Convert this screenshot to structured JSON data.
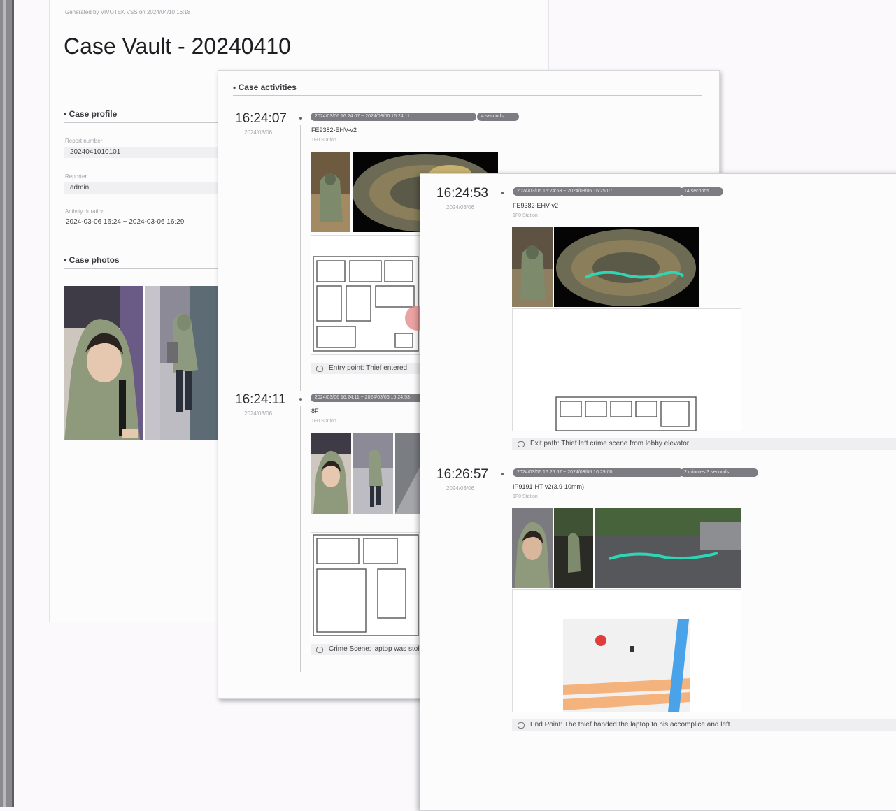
{
  "report": {
    "generated_line": "Generated by VIVOTEK VSS on 2024/04/10 16:18",
    "title": "Case Vault - 20240410",
    "profile": {
      "section_title": "Case profile",
      "report_number_label": "Report number",
      "report_number": "2024041010101",
      "reporter_label": "Reporter",
      "reporter": "admin",
      "duration_label": "Activity duration",
      "duration": "2024-03-06 16:24 ~ 2024-03-06 16:29"
    },
    "photos": {
      "section_title": "Case photos"
    }
  },
  "activities": {
    "section_title": "Case activities",
    "items": [
      {
        "time": "16:24:07",
        "date": "2024/03/06",
        "range": "2024/03/06 16:24:07 ~ 2024/03/06 16:24:11",
        "duration": "4 seconds",
        "camera": "FE9382-EHV-v2",
        "station": "1F0 Station",
        "note": "Entry point: Thief entered"
      },
      {
        "time": "16:24:11",
        "date": "2024/03/06",
        "range": "2024/03/06 16:24:11 ~ 2024/03/06 16:24:53",
        "duration": "",
        "camera": "8F",
        "station": "1F0 Station",
        "note": "Crime Scene: laptop was stolen"
      },
      {
        "time": "16:24:53",
        "date": "2024/03/06",
        "range": "2024/03/06 16:24:53 ~ 2024/03/06 16:25:07",
        "duration": "14 seconds",
        "camera": "FE9382-EHV-v2",
        "station": "1F0 Station",
        "note": "Exit path: Thief left crime scene from lobby elevator"
      },
      {
        "time": "16:26:57",
        "date": "2024/03/06",
        "range": "2024/03/06 16:26:57 ~ 2024/03/06 16:29:00",
        "duration": "2 minutes 3 seconds",
        "camera": "IP9191-HT-v2(3.9-10mm)",
        "station": "1F0 Station",
        "note": "End Point: The thief handed the laptop to his accomplice and left."
      }
    ]
  },
  "colors": {
    "pill": "#7c7c82",
    "track": "#2fd6b5",
    "map_road": "#f4b27d",
    "map_water": "#4aa3e8",
    "pin": "#e23b3b"
  },
  "icons": [
    "comment-icon",
    "map-pin-icon",
    "bullet-icon"
  ]
}
